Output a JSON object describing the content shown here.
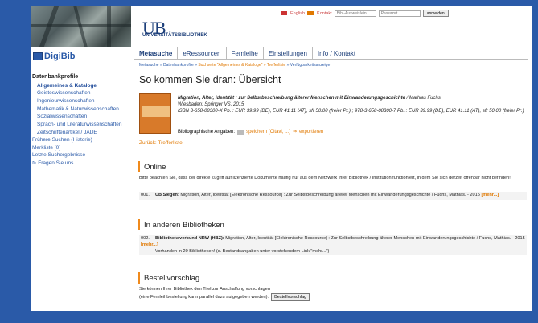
{
  "header": {
    "logo": "UB",
    "logo_sub": "UNIVERSITÄTSBIBLIOTHEK",
    "link_english": "English",
    "link_kontakt": "Kontakt",
    "login_placeholder": "Bib.-Ausweis/ein",
    "password_placeholder": "Passwort",
    "login_button": "anmelden"
  },
  "sidebar": {
    "brand": "DigiBib",
    "heading": "Datenbankprofile",
    "items": [
      "Allgemeines & Kataloge",
      "Geisteswissenschaften",
      "Ingenieurwissenschaften",
      "Mathematik & Naturwissenschaften",
      "Sozialwissenschaften",
      "Sprach- und Literaturwissenschaften",
      "Zeitschriftenartikel / JADE"
    ],
    "links": [
      "Frühere Suchen (Historie)",
      "Merkliste [0]",
      "Letzte Suchergebnisse",
      "Fragen Sie uns"
    ]
  },
  "tabs": [
    "Metasuche",
    "eRessourcen",
    "Fernleihe",
    "Einstellungen",
    "Info / Kontakt"
  ],
  "breadcrumb": {
    "part1": "Metasuche » Datenbankprofile » ",
    "part2": "Suchseite \"Allgemeines & Kataloge\" » Trefferliste",
    "part3": " » Verfügbarkeitsanzeige"
  },
  "page_title": "So kommen Sie dran: Übersicht",
  "record": {
    "title": "Migration, Alter, Identität : zur Selbstbeschreibung älterer Menschen mit Einwanderungsgeschichte",
    "author": " / Mathias Fuchs",
    "imprint": "Wiesbaden: Springer VS, 2015",
    "isbn": "ISBN 3-658-08300-X Pb. : EUR 39.99 (DE), EUR 41.11 (AT), sfr 50.00 (freier Pr.) ; 978-3-658-08300-7 Pb. : EUR 39.99 (DE), EUR 41.11 (AT), sfr 50.00 (freier Pr.)",
    "bib_label": "Bibliographische Angaben:",
    "save_label": "speichern (Citavi, ...)",
    "export_label": "exportieren"
  },
  "back_link": "Zurück: Trefferliste",
  "online": {
    "heading": "Online",
    "note": "Bitte beachten Sie, dass der direkte Zugriff auf lizenzierte Dokumente häufig nur aus dem Netzwerk Ihrer Bibliothek / Institution funktioniert, in dem Sie sich derzeit offenbar nicht befinden!",
    "hit_num": "001.",
    "hit_source": "UB Siegen:",
    "hit_text": " Migration, Alter, Identität [Elektronische Ressource] : Zur Selbstbeschreibung älterer Menschen mit Einwanderungsgeschichte / Fuchs, Mathias. - 2015 ",
    "hit_more": "[mehr...]"
  },
  "other": {
    "heading": "In anderen Bibliotheken",
    "hit_num": "002.",
    "hit_source": "Bibliotheksverbund NRW (HBZ):",
    "hit_text": " Migration, Alter, Identität [Elektronische Ressource] : Zur Selbstbeschreibung älterer Menschen mit Einwanderungsgeschichte / Fuchs, Mathias. - 2015 ",
    "hit_more": "[mehr...]",
    "available": "Vorhanden in 20 Bibliotheken! (s. Bestandsangaben unter vorstehendem Link \"mehr...\")"
  },
  "order": {
    "heading": "Bestellvorschlag",
    "line1": "Sie können Ihrer Bibliothek den Titel zur Anschaffung vorschlagen",
    "line2": "(eine Fernleihbestellung kann parallel dazu aufgegeben werden):",
    "button": "Bestellvorschlag"
  }
}
